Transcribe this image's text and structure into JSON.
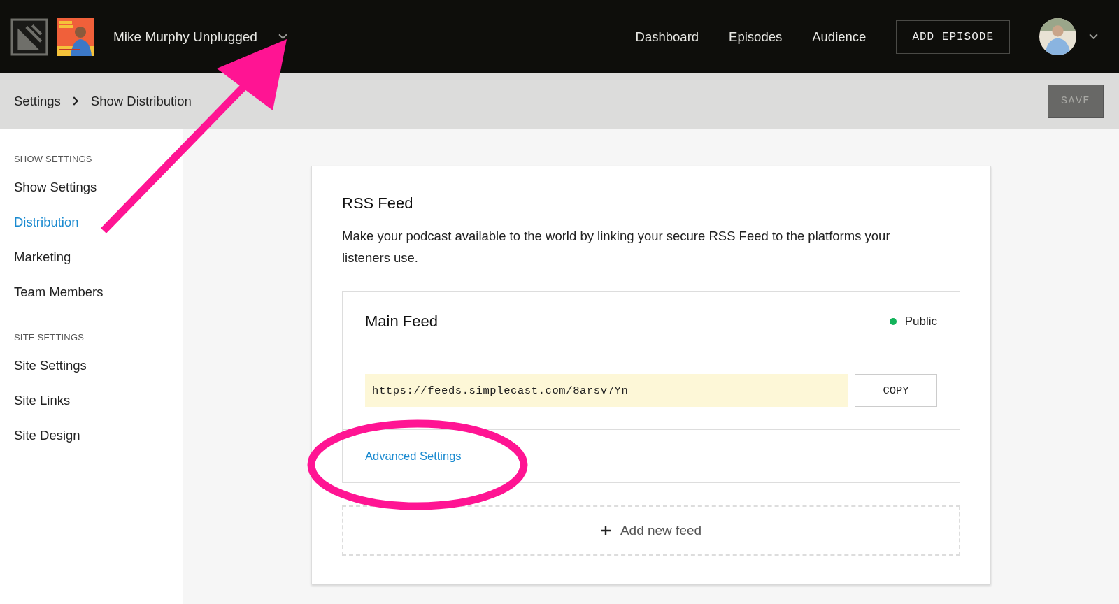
{
  "header": {
    "show_name": "Mike Murphy Unplugged",
    "nav": [
      {
        "label": "Dashboard"
      },
      {
        "label": "Episodes"
      },
      {
        "label": "Audience"
      }
    ],
    "add_button": "ADD EPISODE"
  },
  "breadcrumb": {
    "items": [
      "Settings",
      "Show Distribution"
    ],
    "save_button": {
      "label": "SAVE",
      "disabled": true
    }
  },
  "sidebar": {
    "sections": [
      {
        "heading": "SHOW SETTINGS",
        "items": [
          {
            "label": "Show Settings",
            "selected": false
          },
          {
            "label": "Distribution",
            "selected": true
          },
          {
            "label": "Marketing",
            "selected": false
          },
          {
            "label": "Team Members",
            "selected": false
          }
        ]
      },
      {
        "heading": "SITE SETTINGS",
        "items": [
          {
            "label": "Site Settings",
            "selected": false
          },
          {
            "label": "Site Links",
            "selected": false
          },
          {
            "label": "Site Design",
            "selected": false
          }
        ]
      }
    ]
  },
  "rss": {
    "title": "RSS Feed",
    "description": "Make your podcast available to the world by linking your secure RSS Feed to the platforms your listeners use.",
    "feeds": [
      {
        "name": "Main Feed",
        "status": "Public",
        "color": "#12b35a",
        "url": "https://feeds.simplecast.com/8arsv7Yn",
        "copy_button": "COPY",
        "advanced_link": "Advanced Settings"
      }
    ],
    "add_feed": "Add new feed"
  },
  "annotations": {
    "arrow": true,
    "ellipse": true
  }
}
